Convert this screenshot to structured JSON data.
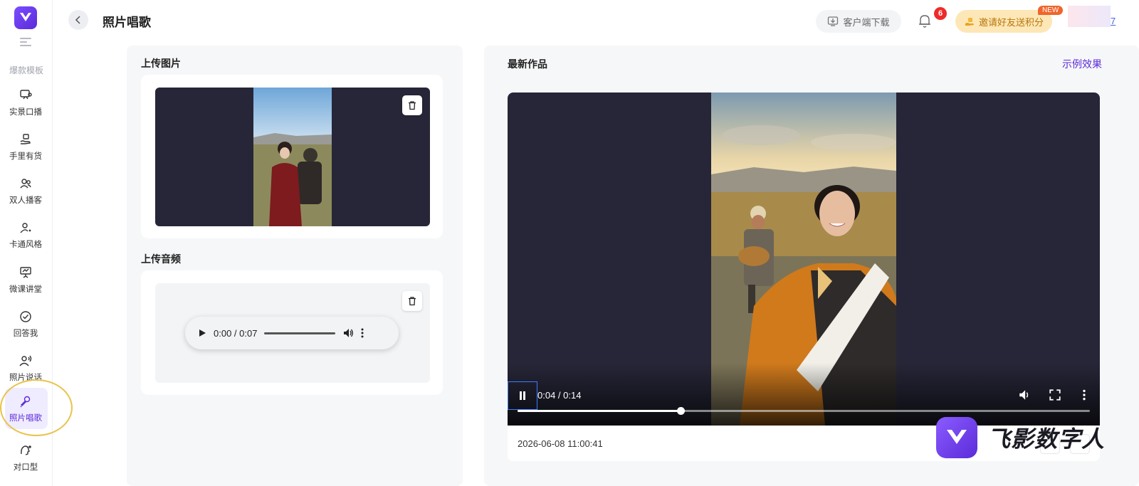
{
  "sidebar": {
    "section_label": "爆款模板",
    "items": [
      {
        "label": "实景口播"
      },
      {
        "label": "手里有货"
      },
      {
        "label": "双人播客"
      },
      {
        "label": "卡通风格"
      },
      {
        "label": "微课讲堂"
      },
      {
        "label": "回答我"
      },
      {
        "label": "照片说话"
      },
      {
        "label": "照片唱歌",
        "active": true
      },
      {
        "label": "对口型"
      }
    ]
  },
  "header": {
    "title": "照片唱歌",
    "download_label": "客户端下载",
    "notification_count": "6",
    "invite_label": "邀请好友送积分",
    "new_badge": "NEW",
    "user_number": "7"
  },
  "upload": {
    "image_title": "上传图片",
    "audio_title": "上传音频",
    "audio_time": "0:00 / 0:07"
  },
  "works": {
    "title": "最新作品",
    "example_link": "示例效果",
    "video_time": "0:04 / 0:14",
    "video_progress": 0.285,
    "timestamp": "2026-06-08 11:00:41"
  },
  "watermark": {
    "text": "飞影数字人"
  },
  "colors": {
    "accent": "#5b2bd9",
    "badge_red": "#ee2b2b",
    "invite_bg": "#fde7b6"
  }
}
